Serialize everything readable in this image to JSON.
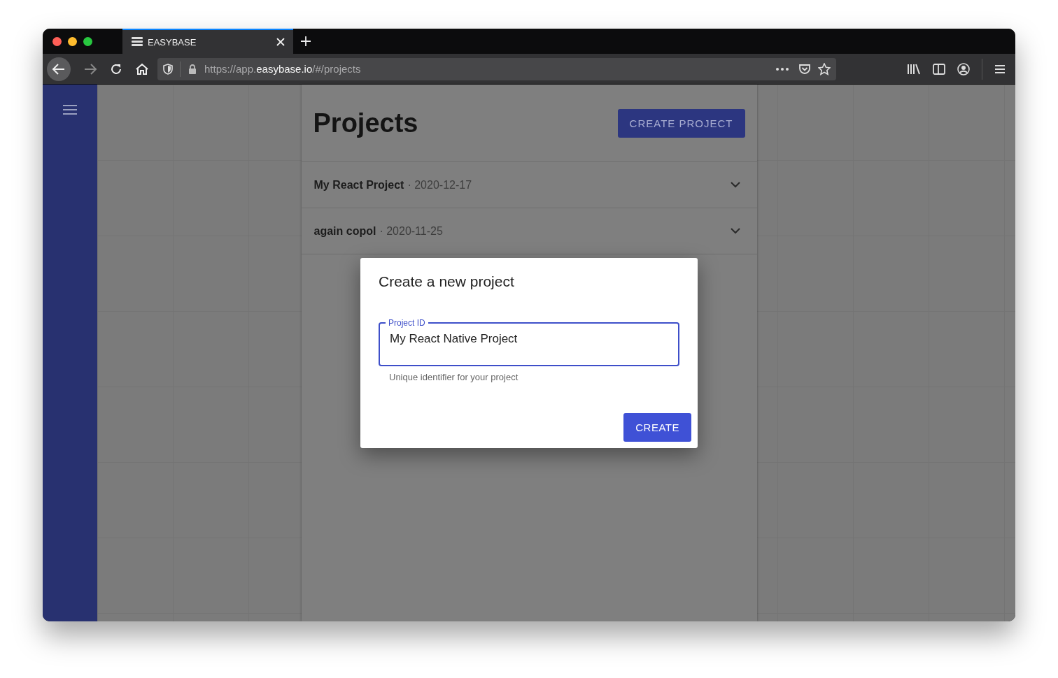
{
  "browser": {
    "tabs": [
      {
        "title": "EASYBASE",
        "selected": true
      }
    ],
    "url": {
      "scheme": "https://app.",
      "host": "easybase.io",
      "path": "/#/projects"
    }
  },
  "page": {
    "title": "Projects",
    "create_button": "CREATE PROJECT",
    "projects": [
      {
        "name": "My React Project",
        "date": "· 2020-12-17",
        "expanded": false
      },
      {
        "name": "again copol",
        "date": "· 2020-11-25",
        "expanded": false
      }
    ]
  },
  "dialog": {
    "title": "Create a new project",
    "field": {
      "label": "Project ID",
      "value": "My React Native Project",
      "focused": true
    },
    "helper": "Unique identifier for your project",
    "button": "CREATE"
  }
}
